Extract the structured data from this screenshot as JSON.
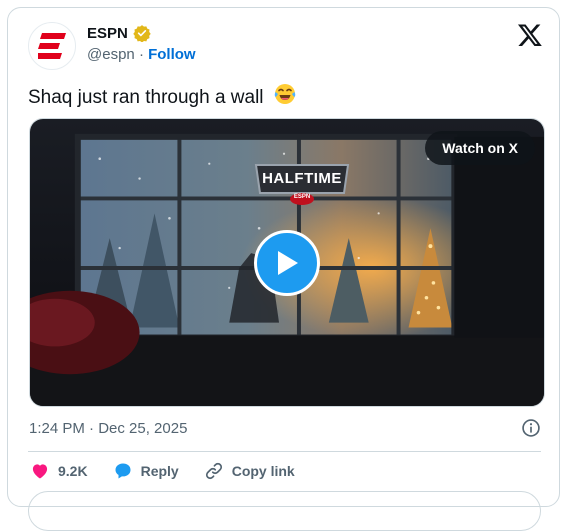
{
  "author": {
    "name": "ESPN",
    "handle": "@espn",
    "separator": "·",
    "follow_label": "Follow",
    "verified": "gold-verified-badge",
    "avatar_logo": "espn-e-logo"
  },
  "tweet": {
    "text": "Shaq just ran through a wall",
    "emoji": "face-with-tears-of-joy"
  },
  "media": {
    "watch_label": "Watch on X",
    "banner": "HALFTIME",
    "banner_sub": "ESPN"
  },
  "meta": {
    "timestamp": "1:24 PM · Dec 25, 2025"
  },
  "actions": {
    "likes": "9.2K",
    "reply_label": "Reply",
    "copy_label": "Copy link"
  },
  "colors": {
    "accent": "#1d9bf0",
    "follow": "#006fd6",
    "like": "#f91880",
    "espn_red": "#e0001b",
    "verified_gold": "#e2b719"
  }
}
